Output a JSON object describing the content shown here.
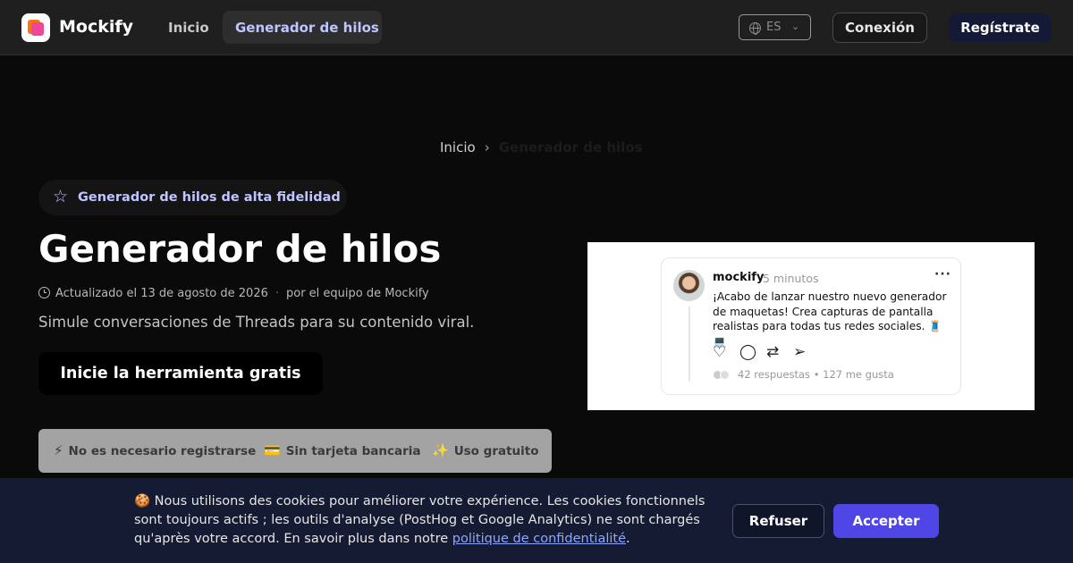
{
  "header": {
    "brand": "Mockify",
    "nav": {
      "home": "Inicio",
      "active": "Generador de hilos"
    },
    "language": {
      "code": "ES",
      "icon": "globe-icon"
    },
    "login_label": "Conexión",
    "signup_label": "Regístrate"
  },
  "breadcrumb": {
    "home": "Inicio",
    "separator": "›",
    "current": "Generador de hilos"
  },
  "hero": {
    "badge": "Generador de hilos de alta fidelidad",
    "title": "Generador de hilos",
    "updated": "Actualizado el 13 de agosto de 2026",
    "meta_separator": "·",
    "author": "por el equipo de Mockify",
    "subtitle": "Simule conversaciones de Threads para su contenido viral.",
    "cta_label": "Inicie la herramienta gratis",
    "features": [
      {
        "icon": "⚡",
        "label": "No es necesario registrarse"
      },
      {
        "icon": "💳",
        "label": "Sin tarjeta bancaria"
      },
      {
        "icon": "✨",
        "label": "Uso gratuito"
      }
    ]
  },
  "preview_post": {
    "username": "mockify",
    "time": "5 minutos",
    "more": "···",
    "text": "¡Acabo de lanzar nuestro nuevo generador de maquetas! Crea capturas de pantalla realistas para todas tus redes sociales. 🧵💻",
    "stats": "42 respuestas • 127 me gusta"
  },
  "cookie_banner": {
    "text_before": "🍪 Nous utilisons des cookies pour améliorer votre expérience. Les cookies fonctionnels sont toujours actifs ; les outils d'analyse (PostHog et Google Analytics) ne sont chargés qu'après votre accord. En savoir plus dans notre ",
    "link_text": "politique de confidentialité",
    "text_after": ".",
    "refuse_label": "Refuser",
    "accept_label": "Accepter"
  },
  "colors": {
    "accent": "#5046e5",
    "nav_active_text": "#bfc5ff",
    "cookie_bg": "#151b32"
  }
}
